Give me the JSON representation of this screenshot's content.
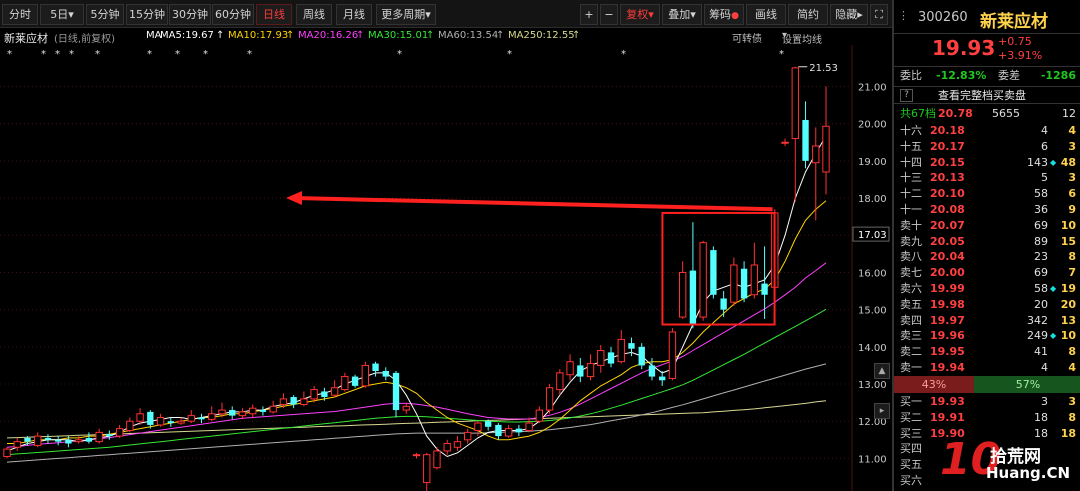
{
  "toolbar": {
    "left": [
      "分时",
      "5日",
      "5分钟",
      "15分钟",
      "30分钟",
      "60分钟",
      "日线",
      "周线",
      "月线",
      "更多周期"
    ],
    "dropdown_5day": "▾",
    "more_caret": "▾",
    "right": {
      "plus": "+",
      "minus": "−",
      "fuquan": "复权▾",
      "diejia": "叠加▾",
      "chouma": "筹码",
      "huaxian": "画线",
      "jianyue": "简约",
      "yincang": "隐藏▸"
    },
    "active": "日线"
  },
  "info": {
    "name": "新莱应材",
    "mode": "(日线,前复权)",
    "ma_label": "MA",
    "ma5": "MA5:19.67",
    "ma10": "MA10:17.93",
    "ma20": "MA20:16.26",
    "ma30": "MA30:15.01",
    "ma60": "MA60:13.54",
    "ma250": "MA250:12.55",
    "convertible": "可转债",
    "set_ma": "设置均线",
    "colors": {
      "ma5": "#ffffff",
      "ma10": "#ffd400",
      "ma20": "#ff40ff",
      "ma30": "#34e834",
      "ma60": "#b0b0b0",
      "ma250": "#d8d890"
    }
  },
  "chart_data": {
    "type": "candlestick",
    "y_ticks": [
      "21.00",
      "20.00",
      "19.00",
      "18.00",
      "17.00",
      "16.00",
      "15.00",
      "14.00",
      "13.00",
      "12.00",
      "11.00"
    ],
    "ylim": [
      10.5,
      21.9
    ],
    "current_price_label": "17.03",
    "high_annotation": "21.53",
    "low_annotation": "10.02",
    "candles": [
      {
        "o": 11.05,
        "c": 11.25,
        "h": 11.3,
        "l": 11.0
      },
      {
        "o": 11.3,
        "c": 11.45,
        "h": 11.55,
        "l": 11.2
      },
      {
        "o": 11.55,
        "c": 11.45,
        "h": 11.6,
        "l": 11.35
      },
      {
        "o": 11.35,
        "c": 11.6,
        "h": 11.7,
        "l": 11.3
      },
      {
        "o": 11.55,
        "c": 11.5,
        "h": 11.65,
        "l": 11.4
      },
      {
        "o": 11.5,
        "c": 11.45,
        "h": 11.6,
        "l": 11.35
      },
      {
        "o": 11.5,
        "c": 11.4,
        "h": 11.6,
        "l": 11.3
      },
      {
        "o": 11.45,
        "c": 11.5,
        "h": 11.6,
        "l": 11.4
      },
      {
        "o": 11.55,
        "c": 11.45,
        "h": 11.7,
        "l": 11.4
      },
      {
        "o": 11.45,
        "c": 11.7,
        "h": 11.8,
        "l": 11.4
      },
      {
        "o": 11.65,
        "c": 11.6,
        "h": 11.75,
        "l": 11.5
      },
      {
        "o": 11.6,
        "c": 11.8,
        "h": 11.9,
        "l": 11.55
      },
      {
        "o": 11.75,
        "c": 12.0,
        "h": 12.1,
        "l": 11.7
      },
      {
        "o": 12.0,
        "c": 12.2,
        "h": 12.35,
        "l": 11.9
      },
      {
        "o": 12.25,
        "c": 11.9,
        "h": 12.3,
        "l": 11.8
      },
      {
        "o": 11.9,
        "c": 12.1,
        "h": 12.2,
        "l": 11.85
      },
      {
        "o": 12.0,
        "c": 11.95,
        "h": 12.1,
        "l": 11.85
      },
      {
        "o": 11.95,
        "c": 12.0,
        "h": 12.1,
        "l": 11.9
      },
      {
        "o": 12.0,
        "c": 12.15,
        "h": 12.3,
        "l": 11.95
      },
      {
        "o": 12.1,
        "c": 12.05,
        "h": 12.2,
        "l": 11.95
      },
      {
        "o": 12.05,
        "c": 12.2,
        "h": 12.4,
        "l": 12.0
      },
      {
        "o": 12.2,
        "c": 12.3,
        "h": 12.5,
        "l": 12.1
      },
      {
        "o": 12.3,
        "c": 12.15,
        "h": 12.4,
        "l": 12.05
      },
      {
        "o": 12.15,
        "c": 12.25,
        "h": 12.35,
        "l": 12.05
      },
      {
        "o": 12.2,
        "c": 12.35,
        "h": 12.45,
        "l": 12.1
      },
      {
        "o": 12.3,
        "c": 12.25,
        "h": 12.4,
        "l": 12.15
      },
      {
        "o": 12.25,
        "c": 12.4,
        "h": 12.55,
        "l": 12.2
      },
      {
        "o": 12.45,
        "c": 12.6,
        "h": 12.75,
        "l": 12.35
      },
      {
        "o": 12.65,
        "c": 12.45,
        "h": 12.7,
        "l": 12.35
      },
      {
        "o": 12.45,
        "c": 12.6,
        "h": 12.8,
        "l": 12.4
      },
      {
        "o": 12.6,
        "c": 12.85,
        "h": 12.95,
        "l": 12.5
      },
      {
        "o": 12.8,
        "c": 12.65,
        "h": 12.9,
        "l": 12.55
      },
      {
        "o": 12.7,
        "c": 12.9,
        "h": 13.1,
        "l": 12.65
      },
      {
        "o": 12.85,
        "c": 13.2,
        "h": 13.3,
        "l": 12.8
      },
      {
        "o": 13.2,
        "c": 12.95,
        "h": 13.25,
        "l": 12.9
      },
      {
        "o": 12.95,
        "c": 13.5,
        "h": 13.6,
        "l": 12.9
      },
      {
        "o": 13.55,
        "c": 13.35,
        "h": 13.6,
        "l": 13.2
      },
      {
        "o": 13.35,
        "c": 13.2,
        "h": 13.45,
        "l": 13.1
      },
      {
        "o": 13.3,
        "c": 12.3,
        "h": 13.35,
        "l": 12.1
      },
      {
        "o": 12.3,
        "c": 12.4,
        "h": 12.5,
        "l": 12.2
      },
      {
        "o": 11.1,
        "c": 11.1,
        "h": 11.15,
        "l": 11.0
      },
      {
        "o": 10.35,
        "c": 11.1,
        "h": 11.15,
        "l": 10.02
      },
      {
        "o": 10.75,
        "c": 11.2,
        "h": 11.3,
        "l": 10.7
      },
      {
        "o": 11.2,
        "c": 11.4,
        "h": 11.5,
        "l": 11.1
      },
      {
        "o": 11.3,
        "c": 11.45,
        "h": 11.6,
        "l": 11.2
      },
      {
        "o": 11.5,
        "c": 11.7,
        "h": 11.8,
        "l": 11.4
      },
      {
        "o": 11.75,
        "c": 11.95,
        "h": 12.0,
        "l": 11.6
      },
      {
        "o": 12.0,
        "c": 11.85,
        "h": 12.05,
        "l": 11.75
      },
      {
        "o": 11.9,
        "c": 11.6,
        "h": 11.95,
        "l": 11.5
      },
      {
        "o": 11.6,
        "c": 11.8,
        "h": 11.9,
        "l": 11.55
      },
      {
        "o": 11.8,
        "c": 11.7,
        "h": 11.9,
        "l": 11.6
      },
      {
        "o": 11.75,
        "c": 11.95,
        "h": 12.1,
        "l": 11.7
      },
      {
        "o": 12.0,
        "c": 12.3,
        "h": 12.4,
        "l": 11.95
      },
      {
        "o": 12.3,
        "c": 12.9,
        "h": 13.0,
        "l": 12.2
      },
      {
        "o": 12.85,
        "c": 13.3,
        "h": 13.4,
        "l": 12.7
      },
      {
        "o": 13.25,
        "c": 13.6,
        "h": 13.8,
        "l": 13.1
      },
      {
        "o": 13.5,
        "c": 13.2,
        "h": 13.7,
        "l": 13.05
      },
      {
        "o": 13.2,
        "c": 13.55,
        "h": 13.8,
        "l": 13.1
      },
      {
        "o": 13.5,
        "c": 13.9,
        "h": 14.05,
        "l": 13.3
      },
      {
        "o": 13.85,
        "c": 13.55,
        "h": 14.0,
        "l": 13.45
      },
      {
        "o": 13.6,
        "c": 14.2,
        "h": 14.45,
        "l": 13.55
      },
      {
        "o": 14.1,
        "c": 13.95,
        "h": 14.25,
        "l": 13.75
      },
      {
        "o": 14.0,
        "c": 13.5,
        "h": 14.1,
        "l": 13.4
      },
      {
        "o": 13.5,
        "c": 13.2,
        "h": 13.7,
        "l": 13.1
      },
      {
        "o": 13.2,
        "c": 13.1,
        "h": 13.35,
        "l": 12.95
      },
      {
        "o": 13.15,
        "c": 14.4,
        "h": 14.5,
        "l": 13.1
      },
      {
        "o": 14.8,
        "c": 16.0,
        "h": 16.3,
        "l": 14.75
      },
      {
        "o": 16.05,
        "c": 14.6,
        "h": 17.35,
        "l": 14.5
      },
      {
        "o": 14.8,
        "c": 16.8,
        "h": 16.85,
        "l": 14.7
      },
      {
        "o": 16.6,
        "c": 15.4,
        "h": 16.7,
        "l": 15.3
      },
      {
        "o": 15.3,
        "c": 15.0,
        "h": 15.5,
        "l": 14.8
      },
      {
        "o": 15.2,
        "c": 16.2,
        "h": 16.4,
        "l": 15.1
      },
      {
        "o": 16.1,
        "c": 15.3,
        "h": 16.3,
        "l": 15.2
      },
      {
        "o": 15.4,
        "c": 16.2,
        "h": 16.8,
        "l": 15.3
      },
      {
        "o": 15.7,
        "c": 15.4,
        "h": 16.7,
        "l": 14.75
      },
      {
        "o": 15.6,
        "c": 17.6,
        "h": 17.7,
        "l": 15.5
      },
      {
        "o": 19.5,
        "c": 19.5,
        "h": 19.6,
        "l": 19.4
      },
      {
        "o": 19.6,
        "c": 21.5,
        "h": 21.53,
        "l": 17.9
      },
      {
        "o": 20.1,
        "c": 19.0,
        "h": 20.6,
        "l": 18.8
      },
      {
        "o": 18.95,
        "c": 19.4,
        "h": 19.9,
        "l": 17.4
      },
      {
        "o": 18.7,
        "c": 19.93,
        "h": 21.0,
        "l": 18.1
      }
    ],
    "ma": {
      "ma5": [
        11.2,
        11.3,
        11.4,
        11.45,
        11.5,
        11.5,
        11.5,
        11.45,
        11.5,
        11.55,
        11.6,
        11.7,
        11.85,
        11.95,
        12.0,
        12.05,
        12.1,
        12.1,
        12.05,
        12.1,
        12.15,
        12.2,
        12.25,
        12.25,
        12.3,
        12.3,
        12.4,
        12.45,
        12.5,
        12.6,
        12.7,
        12.75,
        12.85,
        13.0,
        13.1,
        13.2,
        13.3,
        13.3,
        13.1,
        12.7,
        12.2,
        11.6,
        11.25,
        11.05,
        11.15,
        11.35,
        11.55,
        11.7,
        11.75,
        11.75,
        11.75,
        11.8,
        12.0,
        12.3,
        12.7,
        13.05,
        13.35,
        13.5,
        13.6,
        13.7,
        13.8,
        13.85,
        13.75,
        13.5,
        13.3,
        13.4,
        14.0,
        14.6,
        15.2,
        15.5,
        15.6,
        15.7,
        15.6,
        15.7,
        15.8,
        16.2,
        17.0,
        18.0,
        18.7,
        19.2,
        19.67
      ],
      "ma10": [
        11.4,
        11.4,
        11.45,
        11.5,
        11.5,
        11.5,
        11.55,
        11.55,
        11.6,
        11.6,
        11.65,
        11.7,
        11.75,
        11.8,
        11.85,
        11.9,
        11.95,
        12.0,
        12.05,
        12.1,
        12.1,
        12.15,
        12.2,
        12.2,
        12.25,
        12.3,
        12.35,
        12.4,
        12.45,
        12.5,
        12.55,
        12.6,
        12.65,
        12.75,
        12.85,
        12.95,
        13.0,
        13.05,
        13.0,
        12.9,
        12.75,
        12.5,
        12.3,
        12.1,
        11.95,
        11.85,
        11.75,
        11.6,
        11.5,
        11.5,
        11.55,
        11.6,
        11.7,
        11.85,
        12.05,
        12.3,
        12.55,
        12.75,
        12.95,
        13.1,
        13.25,
        13.45,
        13.55,
        13.6,
        13.6,
        13.65,
        13.85,
        14.1,
        14.4,
        14.65,
        14.9,
        15.15,
        15.3,
        15.45,
        15.55,
        15.8,
        16.3,
        16.9,
        17.4,
        17.7,
        17.93
      ],
      "ma20": [
        11.3,
        11.32,
        11.35,
        11.38,
        11.4,
        11.42,
        11.45,
        11.48,
        11.5,
        11.53,
        11.56,
        11.6,
        11.64,
        11.68,
        11.72,
        11.76,
        11.8,
        11.84,
        11.88,
        11.92,
        11.96,
        12.0,
        12.04,
        12.08,
        12.1,
        12.12,
        12.14,
        12.16,
        12.18,
        12.2,
        12.22,
        12.24,
        12.26,
        12.3,
        12.34,
        12.38,
        12.42,
        12.46,
        12.48,
        12.48,
        12.46,
        12.42,
        12.38,
        12.32,
        12.26,
        12.2,
        12.15,
        12.1,
        12.08,
        12.06,
        12.06,
        12.06,
        12.1,
        12.16,
        12.24,
        12.34,
        12.46,
        12.6,
        12.74,
        12.88,
        13.02,
        13.16,
        13.3,
        13.42,
        13.52,
        13.62,
        13.74,
        13.9,
        14.06,
        14.22,
        14.38,
        14.54,
        14.7,
        14.86,
        15.02,
        15.2,
        15.4,
        15.6,
        15.85,
        16.05,
        16.26
      ],
      "ma30": [
        11.1,
        11.12,
        11.14,
        11.16,
        11.18,
        11.2,
        11.22,
        11.24,
        11.26,
        11.28,
        11.3,
        11.33,
        11.36,
        11.39,
        11.42,
        11.45,
        11.48,
        11.51,
        11.54,
        11.57,
        11.6,
        11.63,
        11.66,
        11.69,
        11.72,
        11.75,
        11.78,
        11.81,
        11.84,
        11.87,
        11.9,
        11.93,
        11.96,
        11.99,
        12.02,
        12.05,
        12.08,
        12.1,
        12.12,
        12.13,
        12.13,
        12.12,
        12.1,
        12.08,
        12.06,
        12.04,
        12.02,
        12.0,
        11.99,
        11.98,
        11.98,
        11.99,
        12.0,
        12.02,
        12.05,
        12.09,
        12.14,
        12.2,
        12.27,
        12.35,
        12.43,
        12.52,
        12.61,
        12.7,
        12.79,
        12.88,
        12.98,
        13.1,
        13.24,
        13.38,
        13.52,
        13.66,
        13.8,
        13.95,
        14.1,
        14.25,
        14.4,
        14.55,
        14.7,
        14.85,
        15.01
      ],
      "ma60": [
        10.9,
        10.92,
        10.94,
        10.96,
        10.98,
        11.0,
        11.02,
        11.04,
        11.06,
        11.08,
        11.1,
        11.12,
        11.14,
        11.16,
        11.18,
        11.2,
        11.22,
        11.24,
        11.26,
        11.28,
        11.3,
        11.32,
        11.34,
        11.36,
        11.38,
        11.4,
        11.42,
        11.44,
        11.46,
        11.48,
        11.5,
        11.52,
        11.54,
        11.56,
        11.58,
        11.6,
        11.62,
        11.64,
        11.66,
        11.67,
        11.68,
        11.68,
        11.68,
        11.68,
        11.68,
        11.68,
        11.68,
        11.69,
        11.7,
        11.71,
        11.72,
        11.73,
        11.75,
        11.77,
        11.8,
        11.83,
        11.87,
        11.91,
        11.96,
        12.01,
        12.06,
        12.11,
        12.17,
        12.23,
        12.3,
        12.37,
        12.44,
        12.52,
        12.6,
        12.68,
        12.76,
        12.84,
        12.92,
        13.0,
        13.08,
        13.16,
        13.24,
        13.32,
        13.4,
        13.47,
        13.54
      ],
      "ma250": [
        11.55,
        11.56,
        11.57,
        11.58,
        11.59,
        11.6,
        11.61,
        11.62,
        11.63,
        11.64,
        11.65,
        11.66,
        11.67,
        11.68,
        11.69,
        11.7,
        11.71,
        11.72,
        11.73,
        11.74,
        11.75,
        11.76,
        11.77,
        11.78,
        11.79,
        11.8,
        11.81,
        11.82,
        11.83,
        11.84,
        11.85,
        11.86,
        11.87,
        11.88,
        11.89,
        11.9,
        11.91,
        11.92,
        11.93,
        11.94,
        11.95,
        11.96,
        11.97,
        11.98,
        11.99,
        12.0,
        12.01,
        12.02,
        12.03,
        12.04,
        12.05,
        12.06,
        12.07,
        12.08,
        12.09,
        12.1,
        12.11,
        12.12,
        12.13,
        12.14,
        12.15,
        12.16,
        12.17,
        12.18,
        12.19,
        12.2,
        12.21,
        12.22,
        12.23,
        12.25,
        12.27,
        12.29,
        12.31,
        12.33,
        12.36,
        12.39,
        12.42,
        12.45,
        12.48,
        12.52,
        12.55
      ]
    }
  },
  "panel": {
    "code": "300260",
    "name": "新莱应材",
    "price": "19.93",
    "change": "+0.75",
    "change_pct": "+3.91%",
    "weibi_label": "委比",
    "weibi": "-12.83%",
    "weicha_label": "委差",
    "weicha": "-1286",
    "view_full": "查看完整档买卖盘",
    "gong_label": "共67档",
    "gong_price": "20.78",
    "gong_vol": "5655",
    "gong_cnt": "12",
    "sells": [
      {
        "label": "十六",
        "price": "20.18",
        "vol": "4",
        "dia": false,
        "cnt": "4"
      },
      {
        "label": "十五",
        "price": "20.17",
        "vol": "6",
        "dia": false,
        "cnt": "3"
      },
      {
        "label": "十四",
        "price": "20.15",
        "vol": "143",
        "dia": true,
        "cnt": "48"
      },
      {
        "label": "十三",
        "price": "20.13",
        "vol": "5",
        "dia": false,
        "cnt": "3"
      },
      {
        "label": "十二",
        "price": "20.10",
        "vol": "58",
        "dia": false,
        "cnt": "6"
      },
      {
        "label": "十一",
        "price": "20.08",
        "vol": "36",
        "dia": false,
        "cnt": "9"
      },
      {
        "label": "卖十",
        "price": "20.07",
        "vol": "69",
        "dia": false,
        "cnt": "10"
      },
      {
        "label": "卖九",
        "price": "20.05",
        "vol": "89",
        "dia": false,
        "cnt": "15"
      },
      {
        "label": "卖八",
        "price": "20.04",
        "vol": "23",
        "dia": false,
        "cnt": "8"
      },
      {
        "label": "卖七",
        "price": "20.00",
        "vol": "69",
        "dia": false,
        "cnt": "7"
      },
      {
        "label": "卖六",
        "price": "19.99",
        "vol": "58",
        "dia": true,
        "cnt": "19"
      },
      {
        "label": "卖五",
        "price": "19.98",
        "vol": "20",
        "dia": false,
        "cnt": "20"
      },
      {
        "label": "卖四",
        "price": "19.97",
        "vol": "342",
        "dia": false,
        "cnt": "13"
      },
      {
        "label": "卖三",
        "price": "19.96",
        "vol": "249",
        "dia": true,
        "cnt": "10"
      },
      {
        "label": "卖二",
        "price": "19.95",
        "vol": "41",
        "dia": false,
        "cnt": "8"
      },
      {
        "label": "卖一",
        "price": "19.94",
        "vol": "4",
        "dia": false,
        "cnt": "4"
      }
    ],
    "ratio_sell": "43%",
    "ratio_buy": "57%",
    "buys": [
      {
        "label": "买一",
        "price": "19.93",
        "vol": "3",
        "cnt": "3"
      },
      {
        "label": "买二",
        "price": "19.91",
        "vol": "18",
        "cnt": "8"
      },
      {
        "label": "买三",
        "price": "19.90",
        "vol": "18",
        "cnt": "18"
      },
      {
        "label": "买四",
        "price": "",
        "vol": "",
        "cnt": ""
      },
      {
        "label": "买五",
        "price": "",
        "vol": "",
        "cnt": ""
      },
      {
        "label": "买六",
        "price": "",
        "vol": "",
        "cnt": ""
      }
    ]
  },
  "watermark": {
    "big": "10",
    "url": "Huang.CN",
    "cn": "拾荒网"
  }
}
